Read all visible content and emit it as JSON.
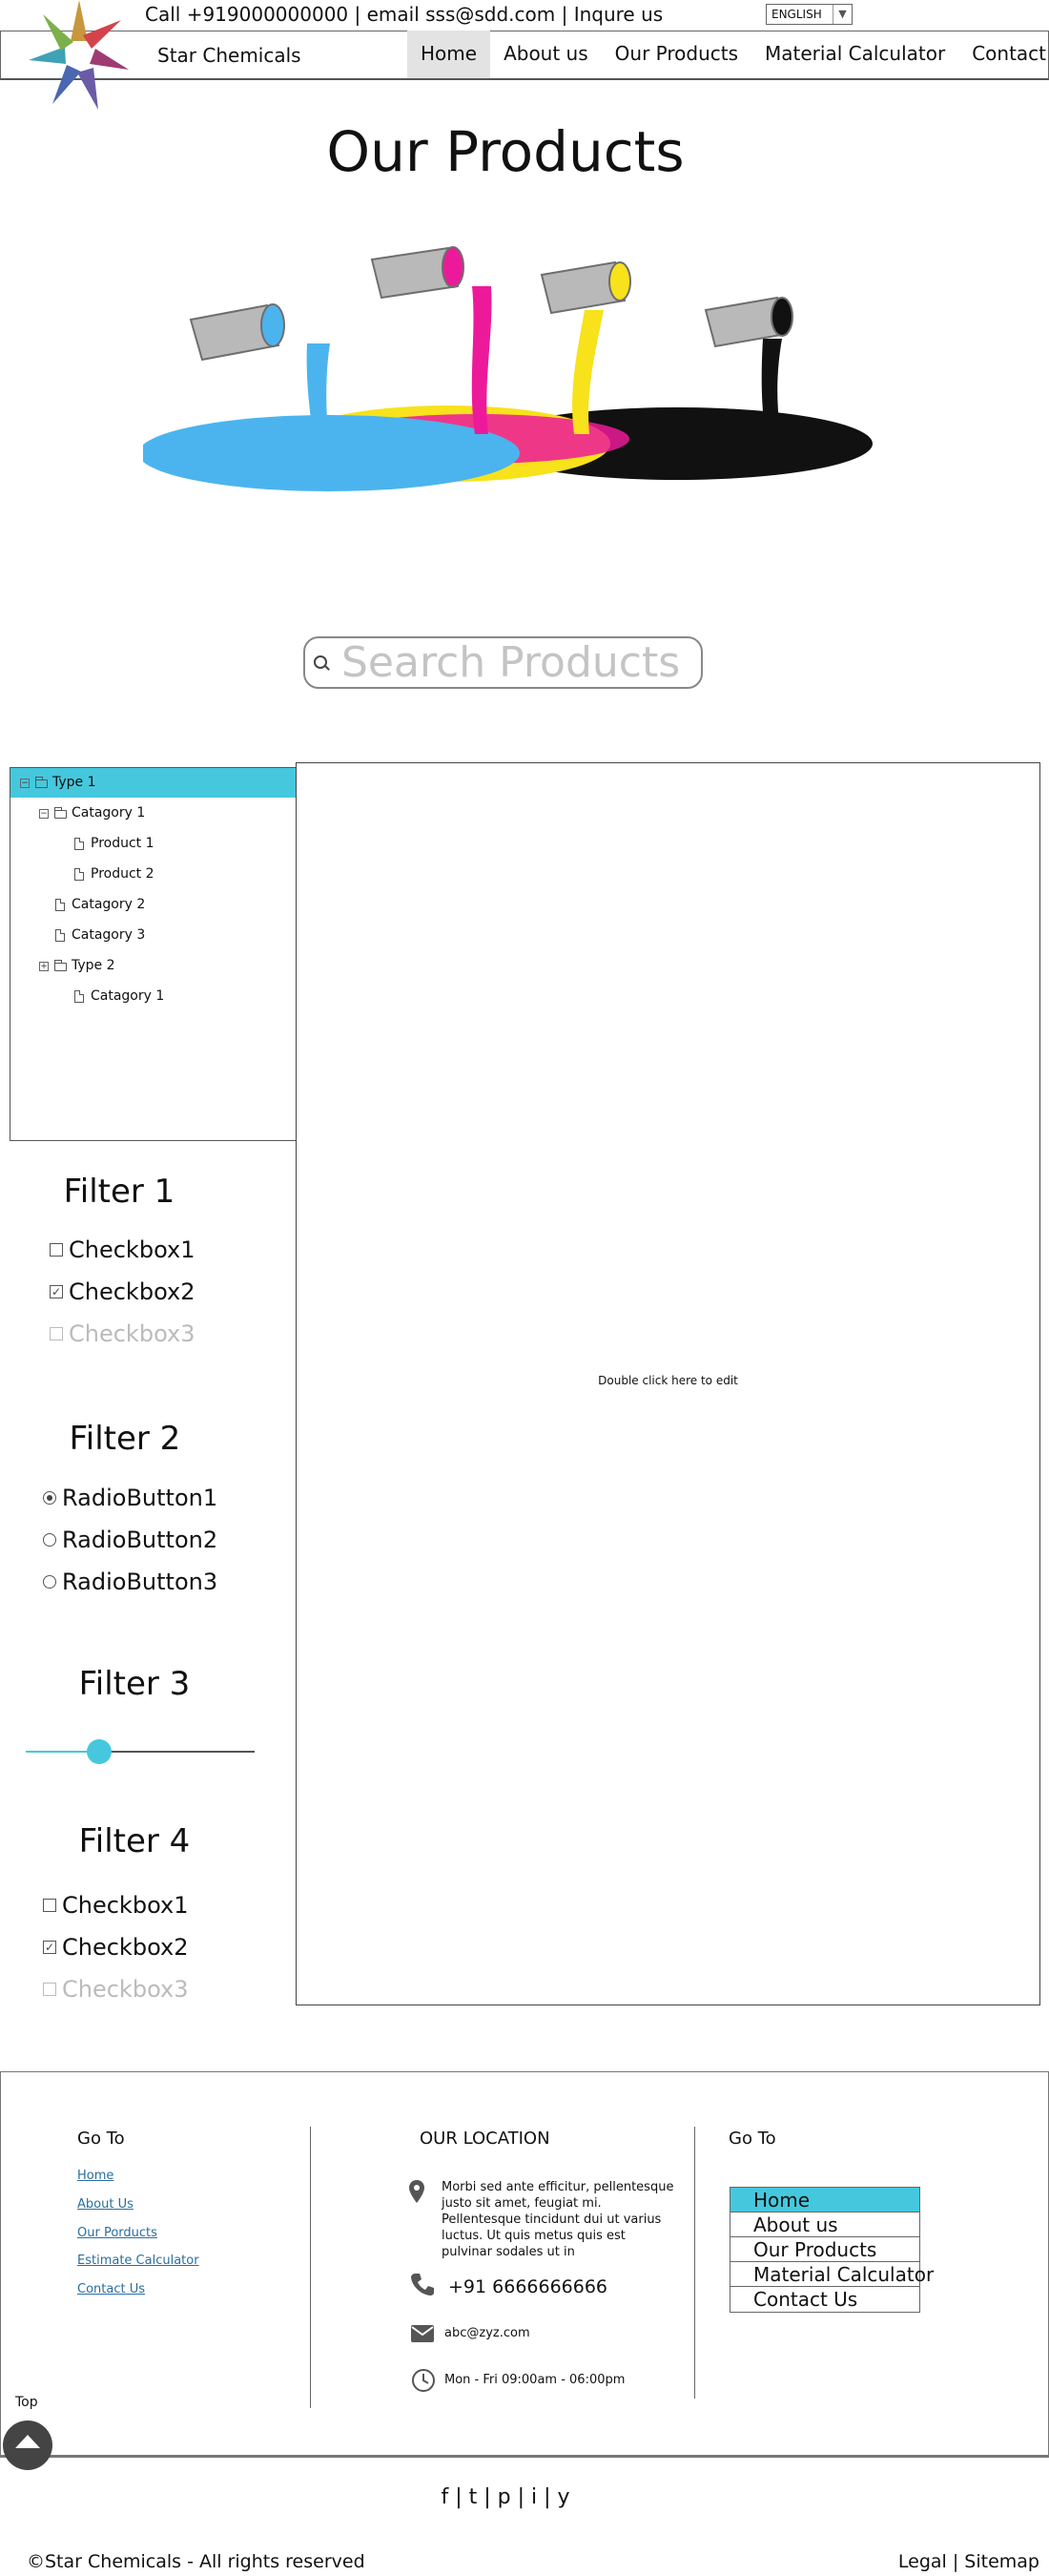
{
  "header": {
    "topbar_text": "Call +919000000000 | email sss@sdd.com | Inqure us",
    "language": "ENGLISH",
    "brand_name": "Star Chemicals",
    "nav": [
      "Home",
      "About us",
      "Our Products",
      "Material Calculator",
      "Contact Us"
    ],
    "active_nav": "Home"
  },
  "hero": {
    "title": "Our Products",
    "search_placeholder": "Search Products"
  },
  "tree": {
    "items": [
      {
        "label": "Type 1",
        "selected": true,
        "toggle": "−",
        "icon": "folder-icon"
      },
      {
        "label": "Catagory 1",
        "toggle": "−",
        "icon": "folder-icon"
      },
      {
        "label": "Product 1",
        "icon": "file-icon"
      },
      {
        "label": "Product 2",
        "icon": "file-icon"
      },
      {
        "label": "Catagory 2",
        "icon": "file-icon"
      },
      {
        "label": "Catagory 3",
        "icon": "file-icon"
      },
      {
        "label": "Type 2",
        "toggle": "+",
        "icon": "folder-icon"
      },
      {
        "label": "Catagory 1",
        "icon": "file-icon"
      }
    ]
  },
  "filters": {
    "filter1": {
      "title": "Filter 1",
      "options": [
        {
          "label": "Checkbox1",
          "checked": false,
          "disabled": false
        },
        {
          "label": "Checkbox2",
          "checked": true,
          "disabled": false
        },
        {
          "label": "Checkbox3",
          "checked": false,
          "disabled": true
        }
      ]
    },
    "filter2": {
      "title": "Filter 2",
      "options": [
        {
          "label": "RadioButton1",
          "selected": true
        },
        {
          "label": "RadioButton2",
          "selected": false
        },
        {
          "label": "RadioButton3",
          "selected": false
        }
      ]
    },
    "filter3": {
      "title": "Filter 3",
      "slider_value": 0.32
    },
    "filter4": {
      "title": "Filter 4",
      "options": [
        {
          "label": "Checkbox1",
          "checked": false,
          "disabled": false
        },
        {
          "label": "Checkbox2",
          "checked": true,
          "disabled": false
        },
        {
          "label": "Checkbox3",
          "checked": false,
          "disabled": true
        }
      ]
    }
  },
  "content": {
    "hint": "Double click here to edit"
  },
  "footer": {
    "goto_heading": "Go To",
    "links": [
      "Home",
      "About Us",
      "Our Porducts",
      "Estimate Calculator",
      "Contact Us"
    ],
    "location_heading": "OUR LOCATION",
    "address": "Morbi sed ante efficitur, pellentesque justo sit amet, feugiat mi. Pellentesque tincidunt dui ut varius luctus. Ut quis metus quis est pulvinar sodales ut in",
    "phone": "+91 6666666666",
    "email": "abc@zyz.com",
    "hours": "Mon - Fri 09:00am - 06:00pm",
    "goto_heading_2": "Go To",
    "nav_list": [
      "Home",
      "About us",
      "Our Products",
      "Material Calculator",
      "Contact Us"
    ],
    "active_nav": "Home",
    "top_label": "Top",
    "social": "f | t | p | i | y",
    "copyright": "©Star Chemicals - All rights reserved",
    "legal": "Legal | Sitemap"
  },
  "colors": {
    "accent": "#45c8dd",
    "link": "#2a6e9c",
    "paint": [
      "#4bb4ee",
      "#ec1a9a",
      "#f7e21b",
      "#111111"
    ]
  }
}
